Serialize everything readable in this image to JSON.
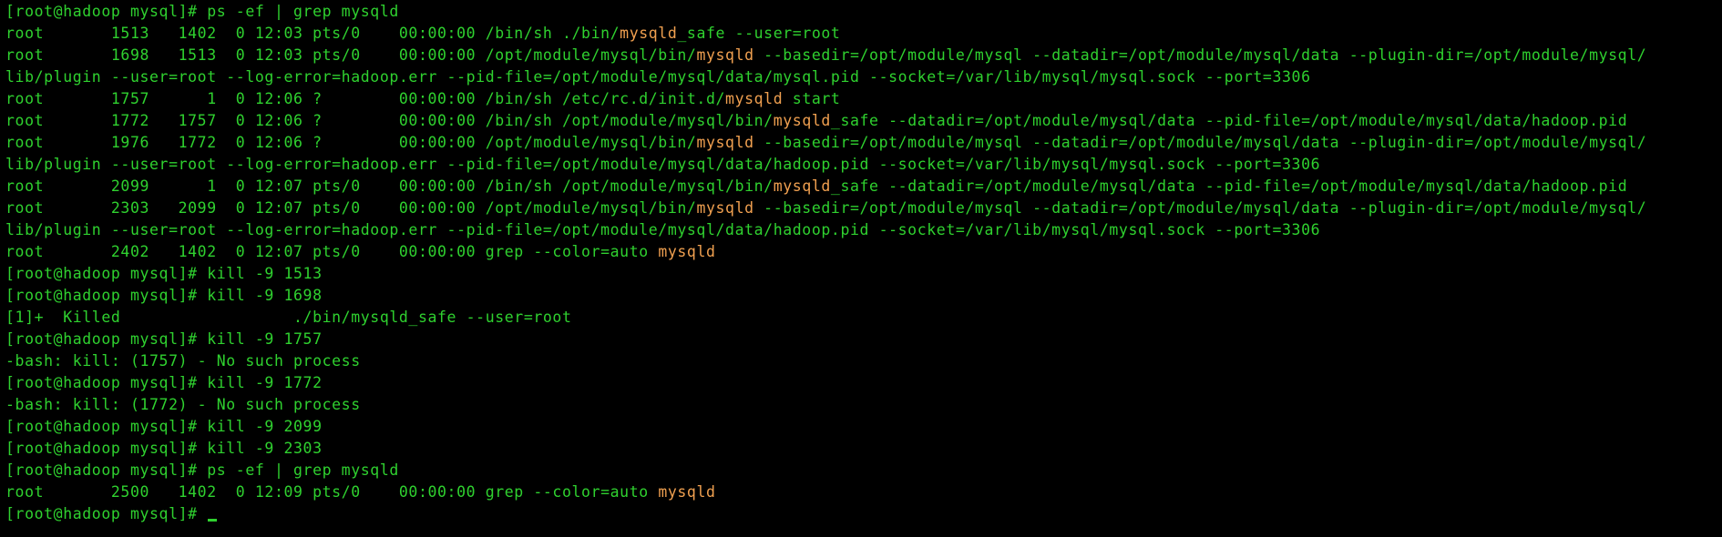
{
  "terminal": {
    "colors": {
      "background": "#000000",
      "text": "#2fd12f",
      "highlight": "#f0a050"
    },
    "lines": [
      [
        {
          "t": "[root@hadoop mysql]# ps -ef | grep mysqld",
          "h": false
        }
      ],
      [
        {
          "t": "root       1513   1402  0 12:03 pts/0    00:00:00 /bin/sh ./bin/",
          "h": false
        },
        {
          "t": "mysqld",
          "h": true
        },
        {
          "t": "_safe --user=root",
          "h": false
        }
      ],
      [
        {
          "t": "root       1698   1513  0 12:03 pts/0    00:00:00 /opt/module/mysql/bin/",
          "h": false
        },
        {
          "t": "mysqld",
          "h": true
        },
        {
          "t": " --basedir=/opt/module/mysql --datadir=/opt/module/mysql/data --plugin-dir=/opt/module/mysql/",
          "h": false
        }
      ],
      [
        {
          "t": "lib/plugin --user=root --log-error=hadoop.err --pid-file=/opt/module/mysql/data/mysql.pid --socket=/var/lib/mysql/mysql.sock --port=3306",
          "h": false
        }
      ],
      [
        {
          "t": "root       1757      1  0 12:06 ?        00:00:00 /bin/sh /etc/rc.d/init.d/",
          "h": false
        },
        {
          "t": "mysqld",
          "h": true
        },
        {
          "t": " start",
          "h": false
        }
      ],
      [
        {
          "t": "root       1772   1757  0 12:06 ?        00:00:00 /bin/sh /opt/module/mysql/bin/",
          "h": false
        },
        {
          "t": "mysqld",
          "h": true
        },
        {
          "t": "_safe --datadir=/opt/module/mysql/data --pid-file=/opt/module/mysql/data/hadoop.pid",
          "h": false
        }
      ],
      [
        {
          "t": "root       1976   1772  0 12:06 ?        00:00:00 /opt/module/mysql/bin/",
          "h": false
        },
        {
          "t": "mysqld",
          "h": true
        },
        {
          "t": " --basedir=/opt/module/mysql --datadir=/opt/module/mysql/data --plugin-dir=/opt/module/mysql/",
          "h": false
        }
      ],
      [
        {
          "t": "lib/plugin --user=root --log-error=hadoop.err --pid-file=/opt/module/mysql/data/hadoop.pid --socket=/var/lib/mysql/mysql.sock --port=3306",
          "h": false
        }
      ],
      [
        {
          "t": "root       2099      1  0 12:07 pts/0    00:00:00 /bin/sh /opt/module/mysql/bin/",
          "h": false
        },
        {
          "t": "mysqld",
          "h": true
        },
        {
          "t": "_safe --datadir=/opt/module/mysql/data --pid-file=/opt/module/mysql/data/hadoop.pid",
          "h": false
        }
      ],
      [
        {
          "t": "root       2303   2099  0 12:07 pts/0    00:00:00 /opt/module/mysql/bin/",
          "h": false
        },
        {
          "t": "mysqld",
          "h": true
        },
        {
          "t": " --basedir=/opt/module/mysql --datadir=/opt/module/mysql/data --plugin-dir=/opt/module/mysql/",
          "h": false
        }
      ],
      [
        {
          "t": "lib/plugin --user=root --log-error=hadoop.err --pid-file=/opt/module/mysql/data/hadoop.pid --socket=/var/lib/mysql/mysql.sock --port=3306",
          "h": false
        }
      ],
      [
        {
          "t": "root       2402   1402  0 12:07 pts/0    00:00:00 grep --color=auto ",
          "h": false
        },
        {
          "t": "mysqld",
          "h": true
        }
      ],
      [
        {
          "t": "[root@hadoop mysql]# kill -9 1513",
          "h": false
        }
      ],
      [
        {
          "t": "[root@hadoop mysql]# kill -9 1698",
          "h": false
        }
      ],
      [
        {
          "t": "[1]+  Killed                  ./bin/mysqld_safe --user=root",
          "h": false
        }
      ],
      [
        {
          "t": "[root@hadoop mysql]# kill -9 1757",
          "h": false
        }
      ],
      [
        {
          "t": "-bash: kill: (1757) - No such process",
          "h": false
        }
      ],
      [
        {
          "t": "[root@hadoop mysql]# kill -9 1772",
          "h": false
        }
      ],
      [
        {
          "t": "-bash: kill: (1772) - No such process",
          "h": false
        }
      ],
      [
        {
          "t": "[root@hadoop mysql]# kill -9 2099",
          "h": false
        }
      ],
      [
        {
          "t": "[root@hadoop mysql]# kill -9 2303",
          "h": false
        }
      ],
      [
        {
          "t": "[root@hadoop mysql]# ps -ef | grep mysqld",
          "h": false
        }
      ],
      [
        {
          "t": "root       2500   1402  0 12:09 pts/0    00:00:00 grep --color=auto ",
          "h": false
        },
        {
          "t": "mysqld",
          "h": true
        }
      ]
    ],
    "prompt": "[root@hadoop mysql]# "
  }
}
